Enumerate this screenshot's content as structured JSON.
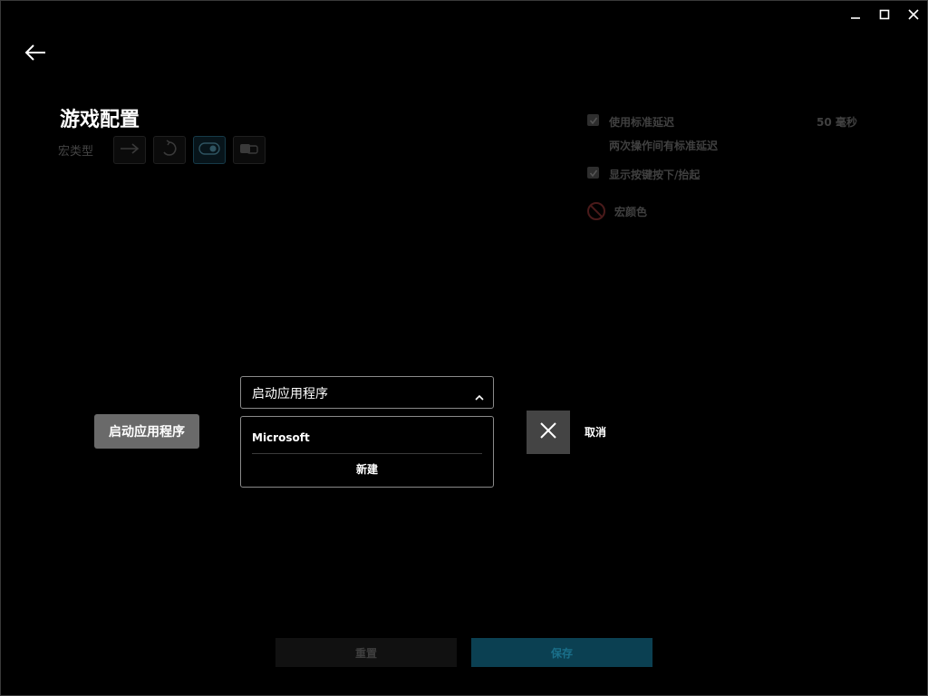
{
  "window": {
    "controls": [
      "minimize-icon",
      "maximize-icon",
      "close-icon"
    ]
  },
  "header": {
    "back_icon": "back-arrow-icon",
    "title": "游戏配置",
    "macro_type_label": "宏类型",
    "macro_types": [
      "arrow-right-icon",
      "repeat-icon",
      "toggle-icon",
      "hold-icon"
    ],
    "active_macro_type_index": 2
  },
  "options": {
    "standard_delay_label": "使用标准延迟",
    "standard_delay_value": "50 毫秒",
    "standard_delay_desc": "两次操作间有标准延迟",
    "show_key_label": "显示按键按下/抬起",
    "macro_color_label": "宏颜色"
  },
  "action": {
    "left_button_label": "启动应用程序",
    "select_value": "启动应用程序",
    "dropdown_items": [
      "Microsoft"
    ],
    "dropdown_new": "新建",
    "cancel_label": "取消"
  },
  "footer": {
    "reset_label": "重置",
    "save_label": "保存"
  },
  "colors": {
    "accent": "#0b4052",
    "background": "#000000"
  }
}
